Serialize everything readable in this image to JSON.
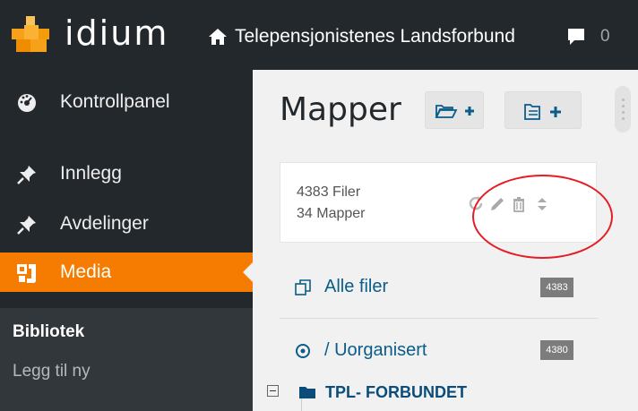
{
  "topbar": {
    "brand": "idium",
    "site_name": "Telepensjonistenes Landsforbund",
    "comment_count": "0"
  },
  "sidebar": {
    "items": [
      {
        "label": "Kontrollpanel",
        "icon": "dashboard-icon"
      },
      {
        "label": "Innlegg",
        "icon": "pin-icon"
      },
      {
        "label": "Avdelinger",
        "icon": "pin-icon"
      },
      {
        "label": "Media",
        "icon": "media-icon"
      }
    ],
    "submenu": [
      {
        "label": "Bibliotek"
      },
      {
        "label": "Legg til ny"
      }
    ]
  },
  "main": {
    "title": "Mapper",
    "stats": {
      "files": "4383 Filer",
      "folders": "34 Mapper"
    },
    "folders": [
      {
        "label": "Alle filer",
        "count": "4383"
      },
      {
        "label": "/ Uorganisert",
        "count": "4380"
      }
    ],
    "tree": [
      {
        "label": "TPL- FORBUNDET"
      }
    ]
  },
  "colors": {
    "adminbar": "#23282d",
    "accent": "#f57c00",
    "link": "#0a5c8a",
    "annotation": "#e51c23"
  }
}
